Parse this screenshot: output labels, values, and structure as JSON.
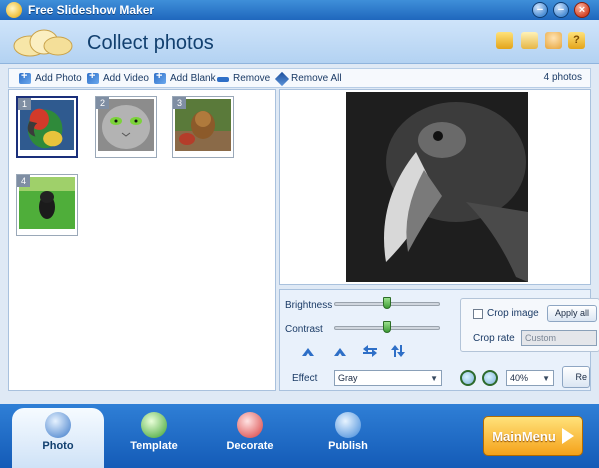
{
  "window": {
    "title": "Free Slideshow Maker"
  },
  "header": {
    "title": "Collect photos"
  },
  "toolbar": {
    "add_photo": "Add Photo",
    "add_video": "Add Video",
    "add_blank": "Add Blank",
    "remove": "Remove",
    "remove_all": "Remove All",
    "photo_count": "4 photos"
  },
  "thumbnails": [
    {
      "num": "1",
      "subject": "parrot",
      "selected": true
    },
    {
      "num": "2",
      "subject": "cat"
    },
    {
      "num": "3",
      "subject": "yorkshire terrier"
    },
    {
      "num": "4",
      "subject": "black puppy on grass"
    }
  ],
  "controls": {
    "brightness_label": "Brightness",
    "brightness_value": 0.5,
    "contrast_label": "Contrast",
    "contrast_value": 0.5,
    "crop_image_label": "Crop image",
    "apply_all_label": "Apply all",
    "crop_rate_label": "Crop rate",
    "crop_rate_value": "Custom",
    "effect_label": "Effect",
    "effect_value": "Gray",
    "zoom_value": "40%",
    "reset_label": "Re"
  },
  "tabs": [
    {
      "label": "Photo"
    },
    {
      "label": "Template"
    },
    {
      "label": "Decorate"
    },
    {
      "label": "Publish"
    }
  ],
  "main_menu_label": "MainMenu",
  "colors": {
    "accent": "#1f67bd",
    "selected_border": "#1a2f7a",
    "main_menu": "#f5a21a"
  }
}
